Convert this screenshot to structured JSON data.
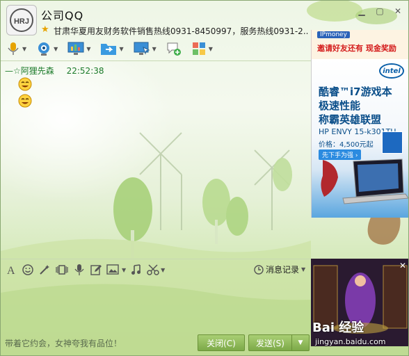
{
  "window": {
    "title": "公司QQ",
    "signature": "甘肃华夏用友财务软件销售热线0931-8450997，服务热线0931-2...",
    "logo_text": "HRJ"
  },
  "toolbar": {
    "icons": [
      "microphone-icon",
      "webcam-icon",
      "screen-share-icon",
      "file-transfer-icon",
      "remote-assist-icon",
      "create-discussion-icon",
      "apps-icon"
    ]
  },
  "chat": {
    "sender": "阿狸先森",
    "time": "22:52:38",
    "emojis": [
      "grin-emoji",
      "grin-emoji"
    ]
  },
  "ads": {
    "top_brand": "IPmoney",
    "top_slogan": "邀请好友还有 现金奖励",
    "laptop_line1": "酷睿™i7游戏本",
    "laptop_line2": "极速性能",
    "laptop_line3": "称霸英雄联盟",
    "laptop_model": "HP ENVY 15-k301TU",
    "laptop_price": "价格：4,500元起",
    "laptop_cta": "先下手为强 ›",
    "intel_badge": "intel",
    "watermark": "Bai 经验",
    "watermark_sub": "jingyan.baidu.com"
  },
  "input_toolbar": {
    "history_label": "消息记录"
  },
  "footer": {
    "ad_text": "带着它约会，女神夸我有品位！",
    "close_label": "关闭(C)",
    "send_label": "发送(S)"
  },
  "colors": {
    "button_green": "#8db85a",
    "accent_green": "#1b7a2a"
  }
}
